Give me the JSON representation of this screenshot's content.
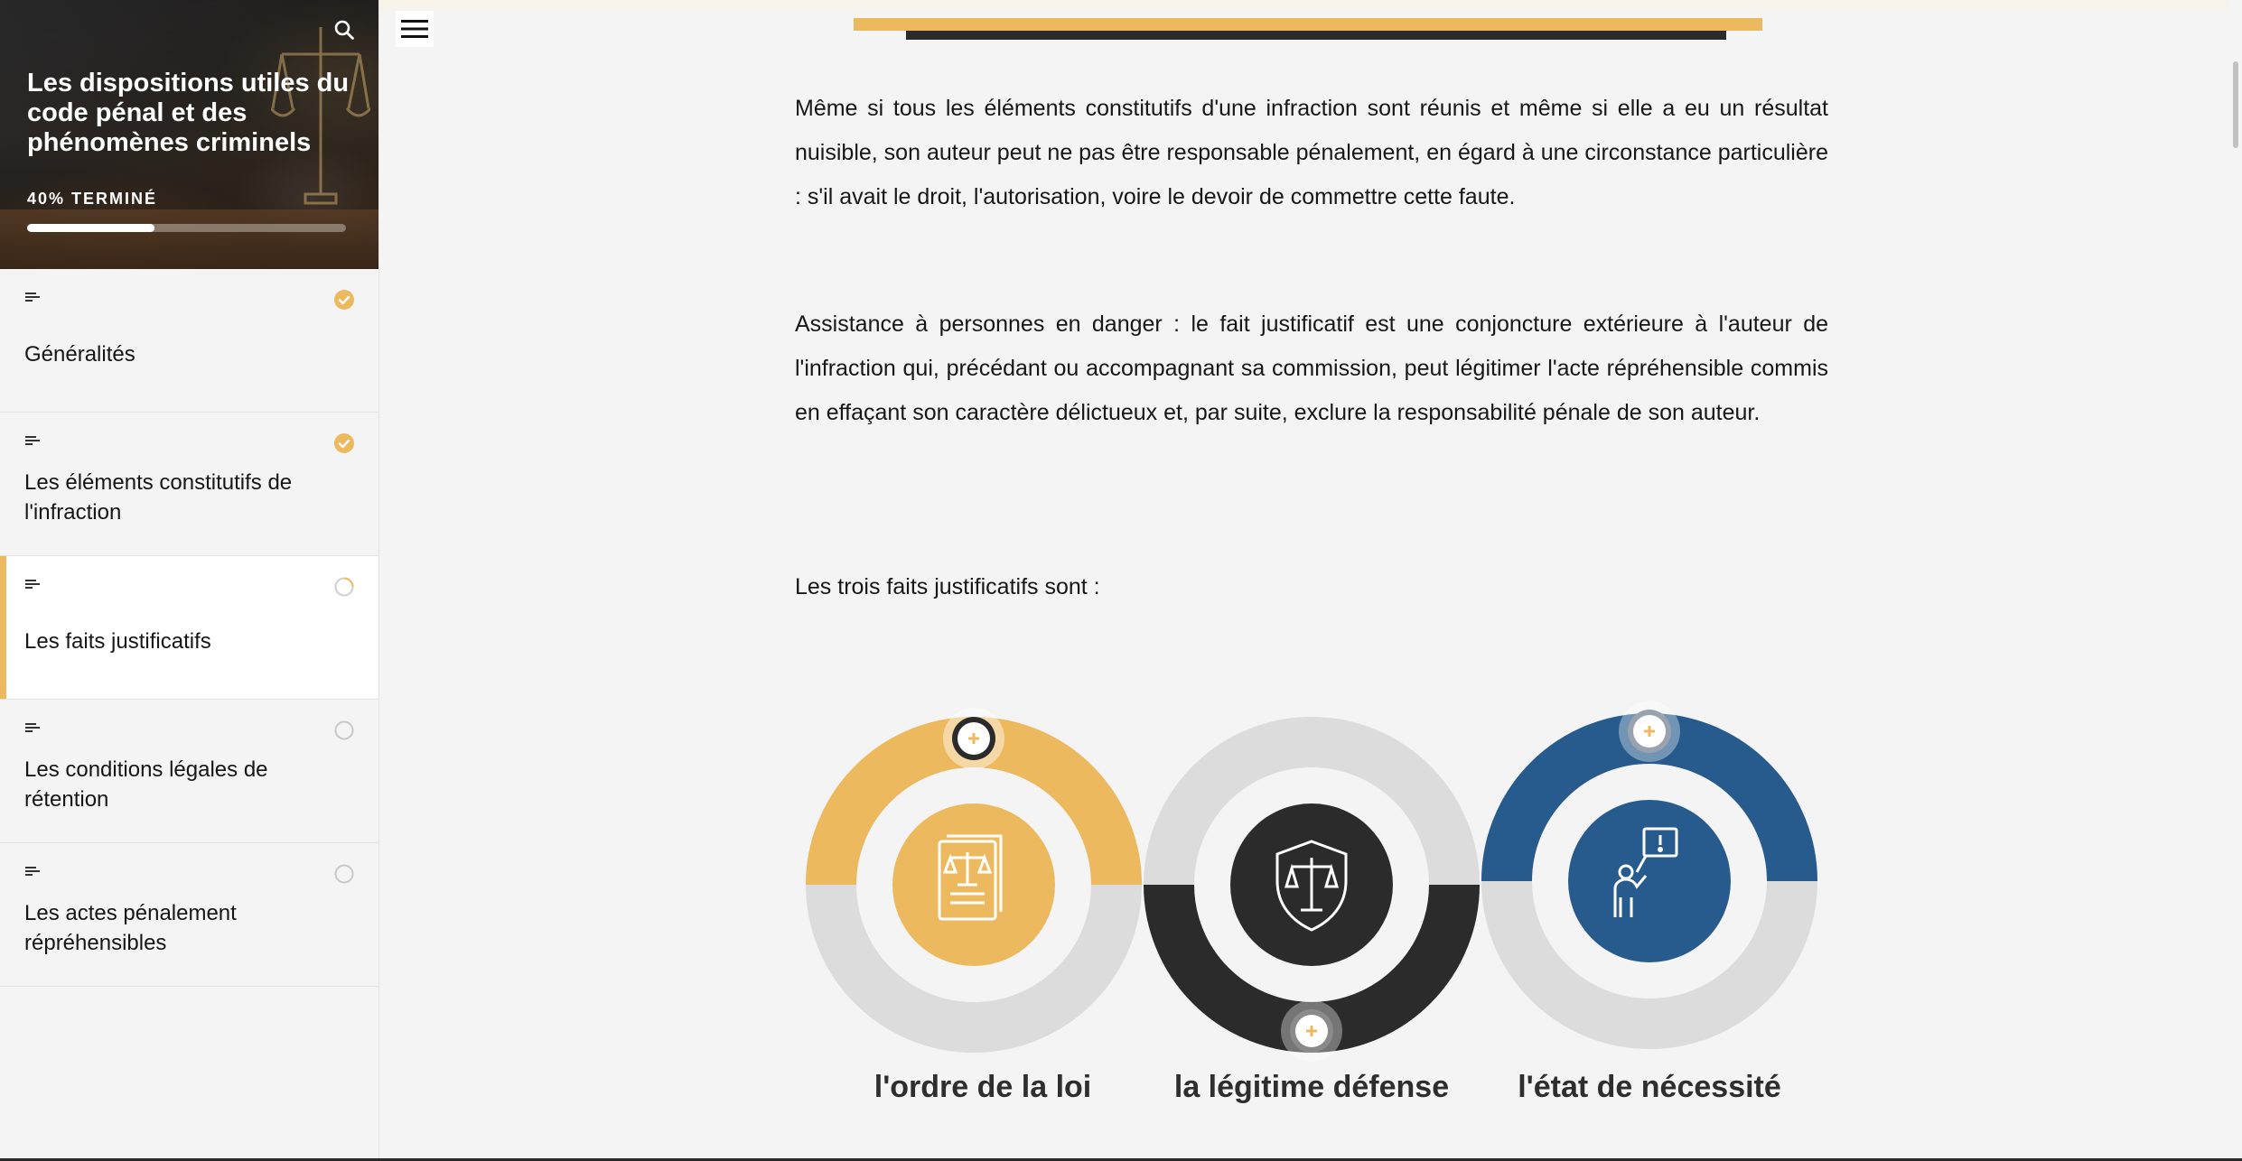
{
  "course": {
    "title": "Les dispositions utiles du code pénal et des phénomènes criminels",
    "progress_label": "40% TERMINÉ",
    "progress_fraction": 0.4
  },
  "lessons": [
    {
      "title": "Généralités",
      "status": "completed"
    },
    {
      "title": "Les éléments constitutifs de l'infraction",
      "status": "completed"
    },
    {
      "title": "Les faits justificatifs",
      "status": "in-progress"
    },
    {
      "title": "Les conditions légales de rétention",
      "status": "not-started"
    },
    {
      "title": "Les actes pénalement répréhensibles",
      "status": "not-started"
    }
  ],
  "content": {
    "paragraph_1": "Même si tous les éléments constitutifs d'une infraction sont réunis et même si elle a eu un résultat nuisible, son auteur peut ne pas être responsable pénalement, en égard à une circonstance particulière : s'il avait le droit, l'autorisation, voire le devoir de commettre cette faute.",
    "paragraph_2": "Assistance à personnes en danger : le fait justificatif est une conjoncture extérieure à l'auteur de l'infraction qui, précédant ou accompagnant sa commission, peut légitimer l'acte répréhensible commis en effaçant son caractère délictueux et, par suite, exclure la responsabilité pénale de son auteur.",
    "paragraph_3": "Les trois faits justificatifs sont :"
  },
  "infographic": {
    "items": [
      {
        "label": "l'ordre de la loi",
        "color": "#edb95e",
        "icon": "law-document-icon"
      },
      {
        "label": "la légitime défense",
        "color": "#2b2b2b",
        "icon": "shield-scale-icon"
      },
      {
        "label": "l'état de nécessité",
        "color": "#275b8e",
        "icon": "person-alert-icon"
      }
    ],
    "track_color": "#dcdcdc"
  },
  "colors": {
    "accent": "#edb95e",
    "dark": "#2b2b2b",
    "blue": "#275b8e"
  }
}
